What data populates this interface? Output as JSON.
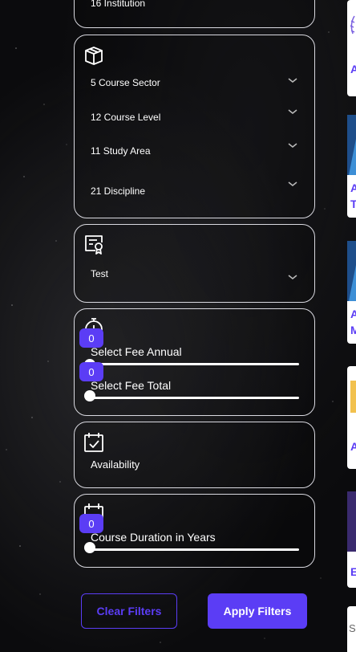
{
  "institution_card": {
    "label": "16 Institution"
  },
  "course_card": {
    "icon": "book-box-icon",
    "items": [
      {
        "label": "5 Course Sector"
      },
      {
        "label": "12 Course Level"
      },
      {
        "label": "11 Study Area"
      },
      {
        "label": "21 Discipline"
      }
    ]
  },
  "test_card": {
    "icon": "certificate-icon",
    "label": "Test"
  },
  "fee_card": {
    "icon": "money-timer-icon",
    "sliders": [
      {
        "label": "Select Fee Annual",
        "value": "0"
      },
      {
        "label": "Select Fee Total",
        "value": "0"
      }
    ]
  },
  "availability_card": {
    "icon": "calendar-check-icon",
    "label": "Availability"
  },
  "duration_card": {
    "icon": "calendar-icon",
    "slider": {
      "label": "Course Duration in Years",
      "value": "0"
    }
  },
  "buttons": {
    "clear": "Clear Filters",
    "apply": "Apply Filters"
  },
  "side_cards": [
    {
      "letter": "A"
    },
    {
      "letter": "A"
    },
    {
      "letter": "T"
    },
    {
      "letter": "A"
    },
    {
      "letter": "M"
    },
    {
      "letter": "A"
    },
    {
      "letter": "E"
    },
    {
      "letter": "S"
    }
  ],
  "colors": {
    "accent": "#5b3df5",
    "border": "#d9d9e0",
    "background": "#0b0b0d"
  }
}
